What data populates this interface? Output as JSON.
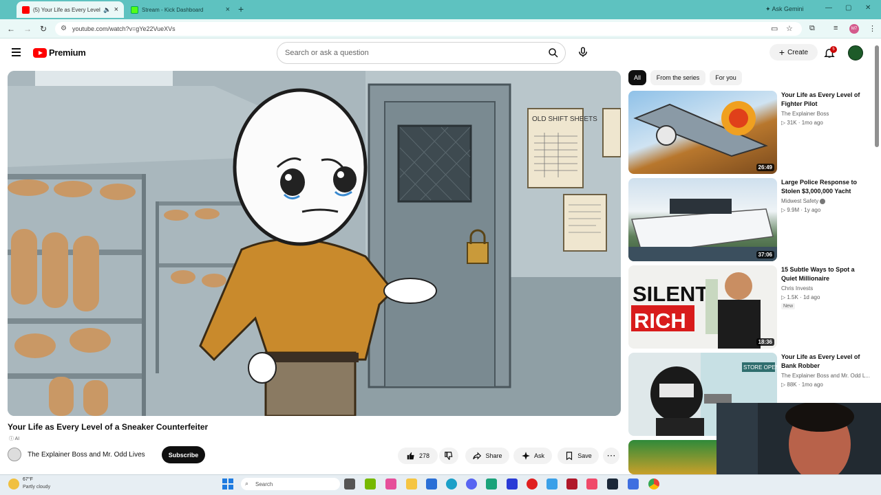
{
  "browser": {
    "tabs": [
      {
        "title": "(5) Your Life as Every Level of a Sneaker Counterfeiter",
        "active": true
      },
      {
        "title": "Stream - Kick Dashboard",
        "active": false
      }
    ],
    "ask_gemini": "Ask Gemini",
    "url": "youtube.com/watch?v=gYe22VueXVs",
    "profile_initials": "M7"
  },
  "header": {
    "logo_text": "Premium",
    "search_placeholder": "Search or ask a question",
    "create_label": "Create",
    "notification_count": "5"
  },
  "video": {
    "title": "Your Life as Every Level of a Sneaker Counterfeiter",
    "ai_label": "AI",
    "channel": "The Explainer Boss and Mr. Odd Lives",
    "subscribe_label": "Subscribe",
    "likes": "278",
    "share_label": "Share",
    "ask_label": "Ask",
    "save_label": "Save",
    "sign_text": "OLD SHIFT SHEETS"
  },
  "sidebar": {
    "chips": [
      "All",
      "From the series",
      "For you"
    ],
    "recommendations": [
      {
        "title": "Your Life as Every Level of Fighter Pilot",
        "channel": "The Explainer Boss",
        "meta": "31K · 1mo ago",
        "duration": "26:49"
      },
      {
        "title": "Large Police Response to Stolen $3,000,000 Yacht",
        "channel": "Midwest Safety",
        "meta": "9.9M · 1y ago",
        "duration": "37:06"
      },
      {
        "title": "15 Subtle Ways to Spot a Quiet Millionaire",
        "channel": "Chris Invests",
        "meta": "1.5K · 1d ago",
        "duration": "18:36",
        "badge": "New",
        "thumb_text_1": "SILENT",
        "thumb_text_2": "RICH"
      },
      {
        "title": "Your Life as Every Level of Bank Robber",
        "channel": "The Explainer Boss and Mr. Odd L...",
        "meta": "88K · 1mo ago",
        "thumb_sign": "STORE OPEN"
      }
    ]
  },
  "taskbar": {
    "temperature": "67°F",
    "weather": "Partly cloudy",
    "search_label": "Search"
  },
  "colors": {
    "youtube_red": "#ff0000",
    "chrome_teal": "#5ec2c0"
  }
}
